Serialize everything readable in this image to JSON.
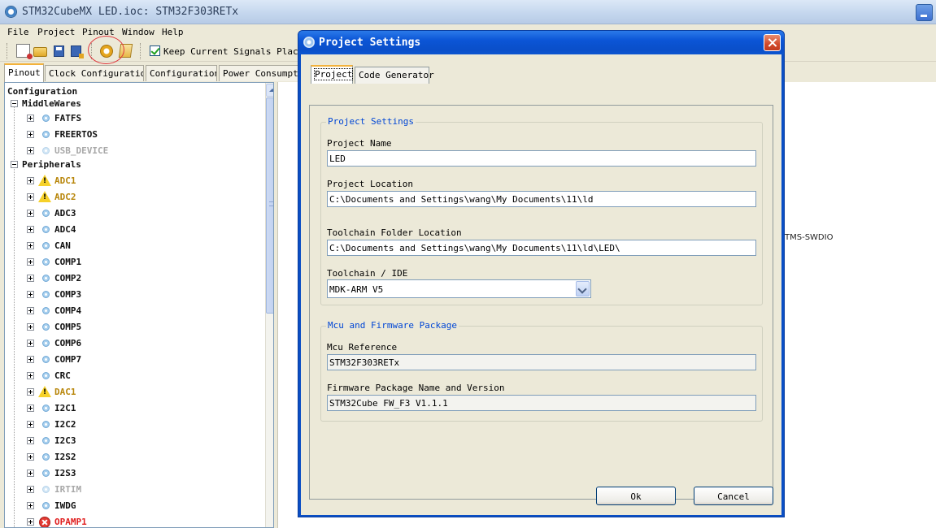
{
  "window": {
    "title": "STM32CubeMX LED.ioc: STM32F303RETx"
  },
  "menubar": {
    "items": [
      "File",
      "Project",
      "Pinout",
      "Window",
      "Help"
    ]
  },
  "toolbar": {
    "keep_signals_label": "Keep Current Signals Placement",
    "keep_signals_checked": true
  },
  "main_tabs": [
    "Pinout",
    "Clock Configuration",
    "Configuration",
    "Power Consumption Calculator"
  ],
  "tree": {
    "root": "Configuration",
    "groups": [
      {
        "label": "MiddleWares",
        "items": [
          {
            "label": "FATFS",
            "status": "normal"
          },
          {
            "label": "FREERTOS",
            "status": "normal"
          },
          {
            "label": "USB_DEVICE",
            "status": "disabled"
          }
        ]
      },
      {
        "label": "Peripherals",
        "items": [
          {
            "label": "ADC1",
            "status": "warning"
          },
          {
            "label": "ADC2",
            "status": "warning"
          },
          {
            "label": "ADC3",
            "status": "normal"
          },
          {
            "label": "ADC4",
            "status": "normal"
          },
          {
            "label": "CAN",
            "status": "normal"
          },
          {
            "label": "COMP1",
            "status": "normal"
          },
          {
            "label": "COMP2",
            "status": "normal"
          },
          {
            "label": "COMP3",
            "status": "normal"
          },
          {
            "label": "COMP4",
            "status": "normal"
          },
          {
            "label": "COMP5",
            "status": "normal"
          },
          {
            "label": "COMP6",
            "status": "normal"
          },
          {
            "label": "COMP7",
            "status": "normal"
          },
          {
            "label": "CRC",
            "status": "normal"
          },
          {
            "label": "DAC1",
            "status": "warning"
          },
          {
            "label": "I2C1",
            "status": "normal"
          },
          {
            "label": "I2C2",
            "status": "normal"
          },
          {
            "label": "I2C3",
            "status": "normal"
          },
          {
            "label": "I2S2",
            "status": "normal"
          },
          {
            "label": "I2S3",
            "status": "normal"
          },
          {
            "label": "IRTIM",
            "status": "disabled"
          },
          {
            "label": "IWDG",
            "status": "normal"
          },
          {
            "label": "OPAMP1",
            "status": "error"
          }
        ]
      }
    ]
  },
  "canvas": {
    "pin_label": "TMS-SWDIO"
  },
  "dialog": {
    "title": "Project Settings",
    "tabs": [
      "Project",
      "Code Generator"
    ],
    "project_group": {
      "title": "Project Settings",
      "name_label": "Project Name",
      "name_value": "LED",
      "location_label": "Project Location",
      "location_value": "C:\\Documents and Settings\\wang\\My Documents\\11\\ld",
      "toolchain_folder_label": "Toolchain Folder Location",
      "toolchain_folder_value": "C:\\Documents and Settings\\wang\\My Documents\\11\\ld\\LED\\",
      "ide_label": "Toolchain / IDE",
      "ide_value": "MDK-ARM V5"
    },
    "mcu_group": {
      "title": "Mcu and Firmware Package",
      "mcu_label": "Mcu Reference",
      "mcu_value": "STM32F303RETx",
      "firmware_label": "Firmware Package Name and Version",
      "firmware_value": "STM32Cube FW_F3 V1.1.1"
    },
    "ok_label": "Ok",
    "cancel_label": "Cancel"
  },
  "colors": {
    "group_title": "#0046d5",
    "warning_text": "#b8860b",
    "error_text": "#e02020",
    "disabled_text": "#a8a8a8",
    "dialog_frame": "#0a4ec4"
  }
}
